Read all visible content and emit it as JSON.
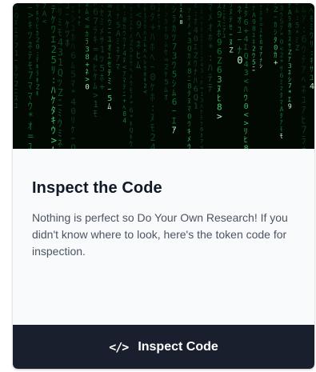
{
  "card": {
    "hero_image": "matrix-code-rain",
    "title": "Inspect the Code",
    "description": "Nothing is perfect so Do Your Own Research! If you didn't know where to look, here's the token code for inspection.",
    "button": {
      "icon": "code-icon",
      "icon_glyph": "</>",
      "label": "Inspect Code"
    }
  },
  "colors": {
    "matrix_green": "#22c55e",
    "button_bg": "#1a1f2e",
    "title_text": "#111827",
    "body_text": "#4b5563"
  }
}
